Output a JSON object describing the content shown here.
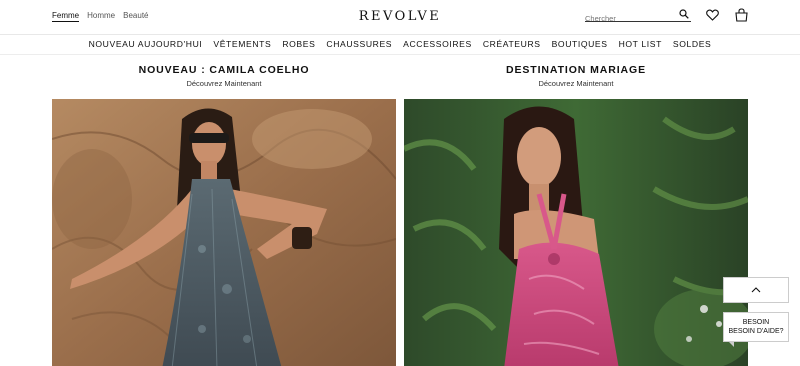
{
  "header": {
    "gender_tabs": [
      "Femme",
      "Homme",
      "Beauté"
    ],
    "logo": "REVOLVE",
    "search_placeholder": "Chercher",
    "icons": [
      "search-icon",
      "heart-icon",
      "bag-icon"
    ]
  },
  "nav": {
    "items": [
      "NOUVEAU AUJOURD'HUI",
      "VÊTEMENTS",
      "ROBES",
      "CHAUSSURES",
      "ACCESSOIRES",
      "CRÉATEURS",
      "BOUTIQUES",
      "HOT LIST",
      "SOLDES"
    ]
  },
  "promos": [
    {
      "title": "NOUVEAU : CAMILA COELHO",
      "subtitle": "Découvrez Maintenant"
    },
    {
      "title": "DESTINATION MARIAGE",
      "subtitle": "Découvrez Maintenant"
    }
  ],
  "widgets": {
    "help_line1": "BESOIN",
    "help_line2": "BESOIN D'AIDE?"
  },
  "colors": {
    "text": "#111111",
    "border": "#cccccc"
  }
}
